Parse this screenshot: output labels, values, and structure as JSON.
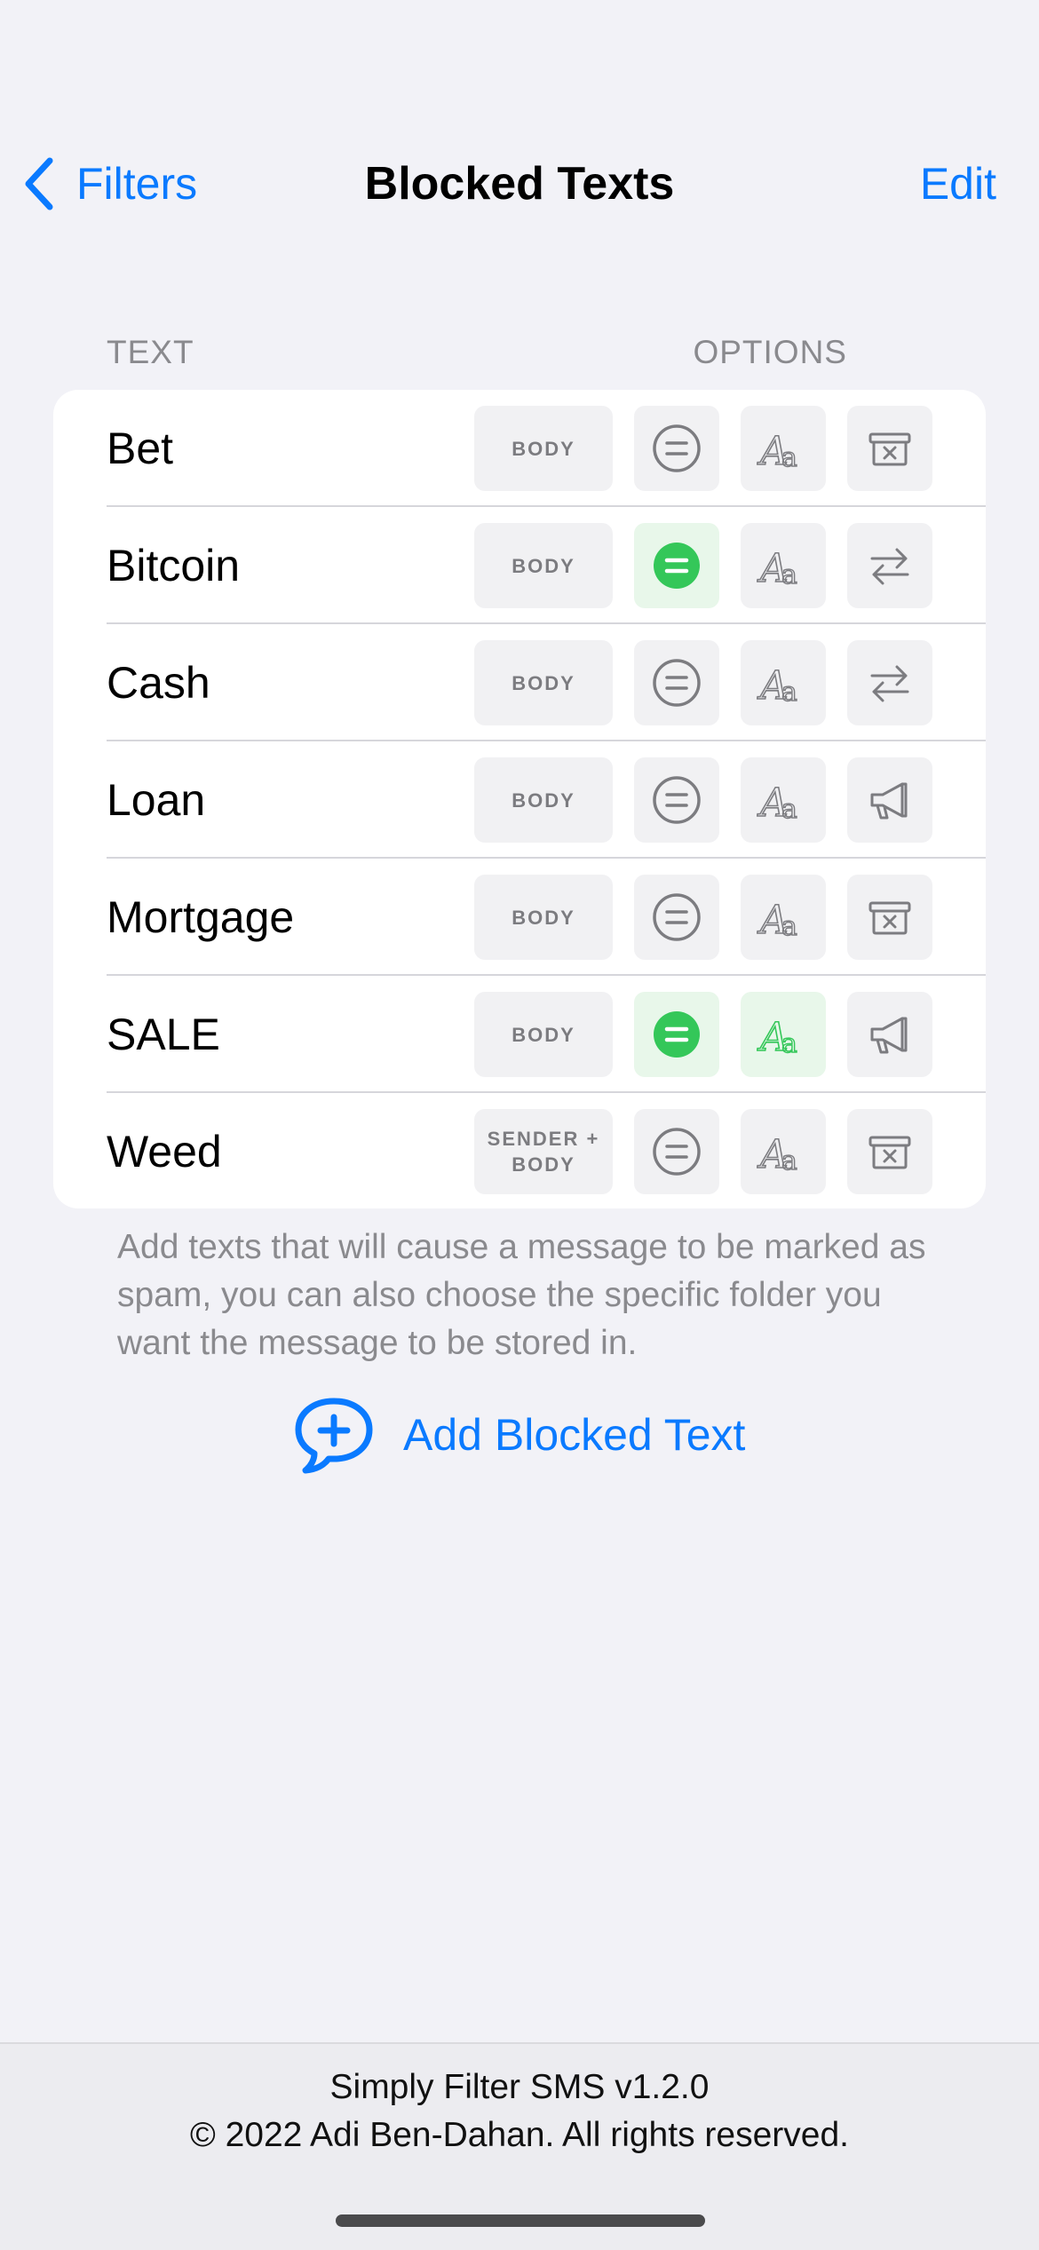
{
  "nav": {
    "back_label": "Filters",
    "title": "Blocked Texts",
    "edit_label": "Edit"
  },
  "section": {
    "header_left": "TEXT",
    "header_right": "OPTIONS",
    "rows": [
      {
        "label": "Bet",
        "target_line1": "BODY",
        "target_line2": "",
        "exact_active": false,
        "case_active": false,
        "folder_icon": "archive-x-icon"
      },
      {
        "label": "Bitcoin",
        "target_line1": "BODY",
        "target_line2": "",
        "exact_active": true,
        "case_active": false,
        "folder_icon": "transfer-arrows-icon"
      },
      {
        "label": "Cash",
        "target_line1": "BODY",
        "target_line2": "",
        "exact_active": false,
        "case_active": false,
        "folder_icon": "transfer-arrows-icon"
      },
      {
        "label": "Loan",
        "target_line1": "BODY",
        "target_line2": "",
        "exact_active": false,
        "case_active": false,
        "folder_icon": "megaphone-icon"
      },
      {
        "label": "Mortgage",
        "target_line1": "BODY",
        "target_line2": "",
        "exact_active": false,
        "case_active": false,
        "folder_icon": "archive-x-icon"
      },
      {
        "label": "SALE",
        "target_line1": "BODY",
        "target_line2": "",
        "exact_active": true,
        "case_active": true,
        "folder_icon": "megaphone-icon"
      },
      {
        "label": "Weed",
        "target_line1": "SENDER +",
        "target_line2": "BODY",
        "exact_active": false,
        "case_active": false,
        "folder_icon": "archive-x-icon"
      }
    ],
    "footer": "Add texts that will cause a message to be marked as spam, you can also choose the specific folder you want the message to be stored in."
  },
  "add_button": {
    "label": "Add Blocked Text"
  },
  "bottom": {
    "line1": "Simply Filter SMS v1.2.0",
    "line2": "© 2022 Adi Ben-Dahan. All rights reserved."
  },
  "colors": {
    "accent": "#0a7aff",
    "active_green": "#34c759",
    "icon_gray": "#7c7c80",
    "background": "#f2f2f7"
  }
}
